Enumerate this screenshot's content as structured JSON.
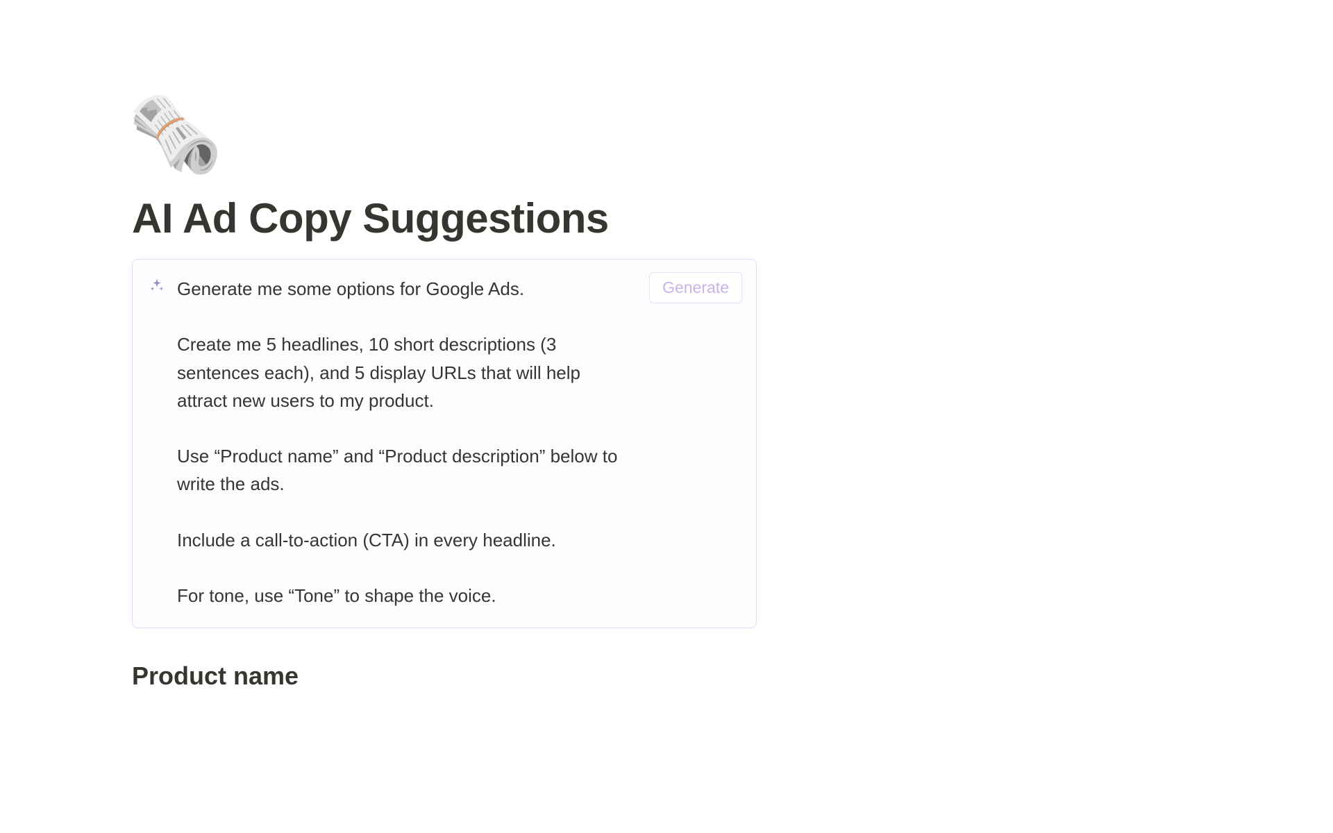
{
  "page": {
    "icon": "🗞️",
    "title": "AI Ad Copy Suggestions"
  },
  "ai_block": {
    "generate_label": "Generate",
    "lines": [
      "Generate me some options for Google Ads.",
      "",
      "Create me 5 headlines, 10 short descriptions (3 sentences each), and 5 display URLs that will help attract new users to my product.",
      "",
      "Use “Product name” and “Product description” below to write the ads.",
      "",
      "Include a call-to-action (CTA) in every headline.",
      "",
      "For tone, use “Tone” to shape the voice."
    ]
  },
  "sections": {
    "product_name_heading": "Product name"
  }
}
